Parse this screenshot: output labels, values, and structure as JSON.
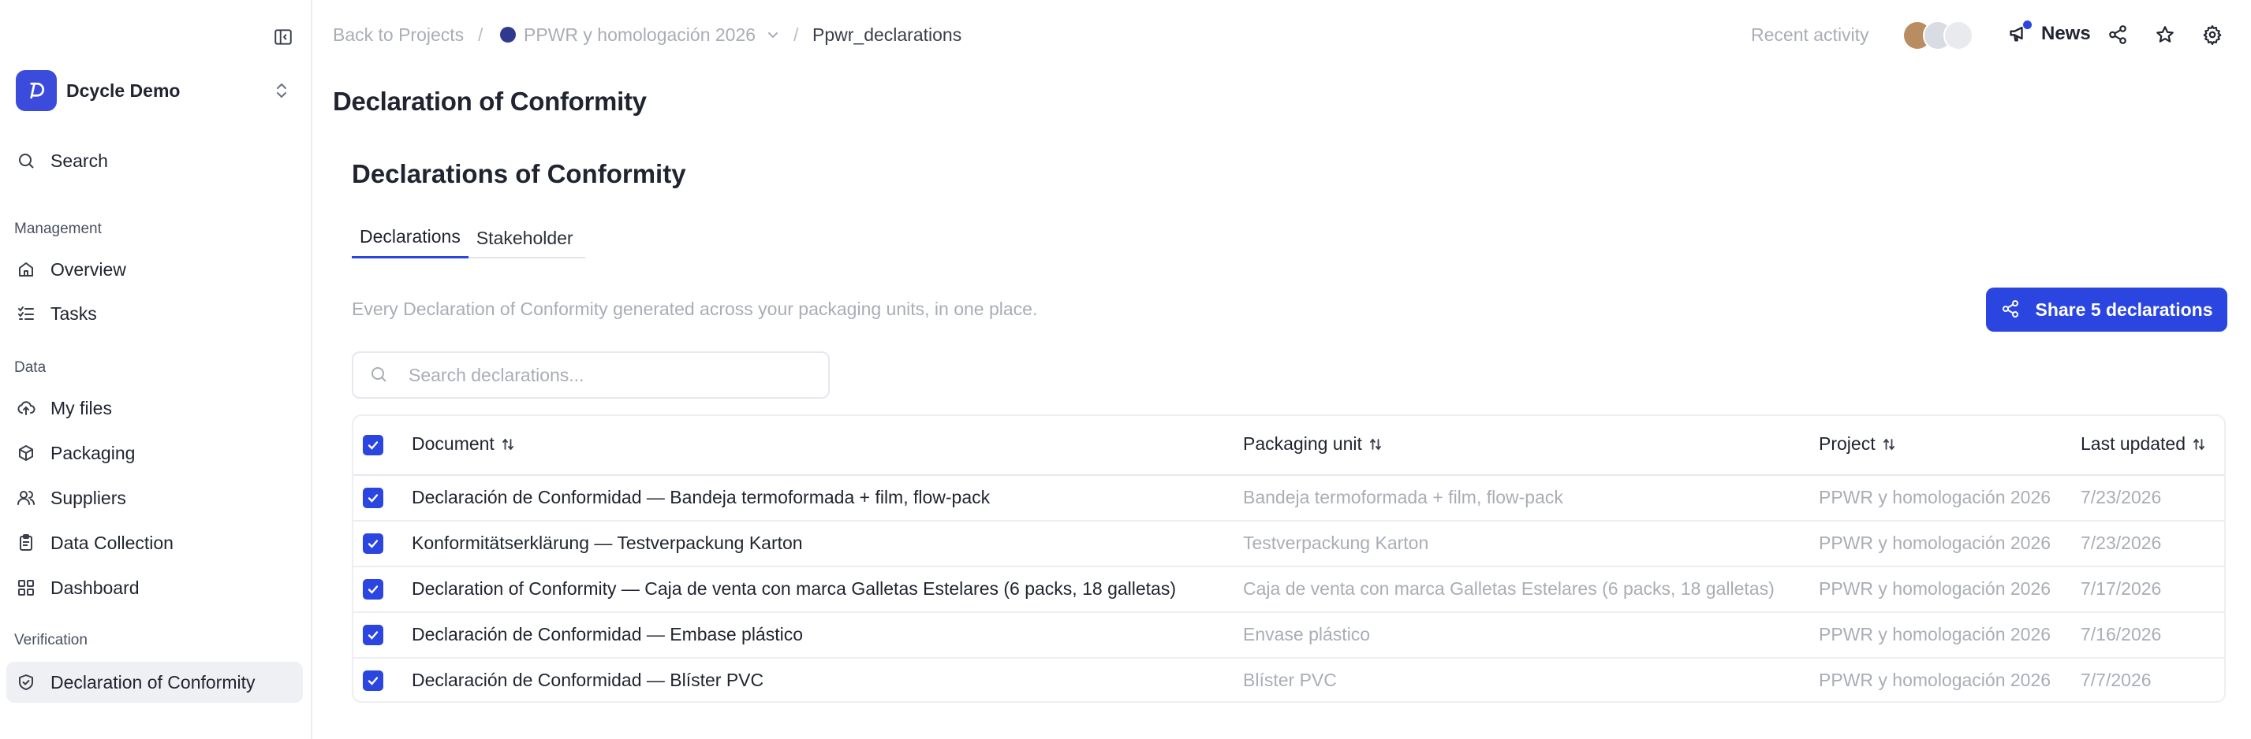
{
  "workspace": {
    "name": "Dcycle Demo"
  },
  "sidebar": {
    "search_label": "Search",
    "sections": [
      {
        "title": "Management"
      },
      {
        "title": "Data"
      },
      {
        "title": "Verification"
      }
    ],
    "items": [
      {
        "label": "Overview",
        "icon": "home-icon"
      },
      {
        "label": "Tasks",
        "icon": "tasks-icon"
      },
      {
        "label": "My files",
        "icon": "upload-cloud-icon"
      },
      {
        "label": "Packaging",
        "icon": "package-icon"
      },
      {
        "label": "Suppliers",
        "icon": "users-icon"
      },
      {
        "label": "Data Collection",
        "icon": "clipboard-icon"
      },
      {
        "label": "Dashboard",
        "icon": "dashboard-icon"
      },
      {
        "label": "Declaration of Conformity",
        "icon": "shield-check-icon",
        "active": true
      }
    ]
  },
  "breadcrumb": {
    "back": "Back to Projects",
    "sep": "/",
    "project": "PPWR y homologación 2026",
    "current": "Ppwr_declarations"
  },
  "topbar": {
    "recent_activity": "Recent activity",
    "news": "News"
  },
  "page": {
    "title": "Declaration of Conformity",
    "card_title": "Declarations of Conformity",
    "tabs": [
      {
        "label": "Declarations",
        "active": true
      },
      {
        "label": "Stakeholder",
        "active": false
      }
    ],
    "subtitle": "Every Declaration of Conformity generated across your packaging units, in one place.",
    "share_button": "Share 5 declarations",
    "search_placeholder": "Search declarations..."
  },
  "table": {
    "columns": [
      "Document",
      "Packaging unit",
      "Project",
      "Last updated"
    ],
    "rows": [
      {
        "document": "Declaración de Conformidad — Bandeja termoformada + film, flow-pack",
        "packaging": "Bandeja termoformada + film, flow-pack",
        "project": "PPWR y homologación 2026",
        "updated": "7/23/2026"
      },
      {
        "document": "Konformitätserklärung — Testverpackung Karton",
        "packaging": "Testverpackung Karton",
        "project": "PPWR y homologación 2026",
        "updated": "7/23/2026"
      },
      {
        "document": "Declaration of Conformity — Caja de venta con marca Galletas Estelares (6 packs, 18 galletas)",
        "packaging": "Caja de venta con marca Galletas Estelares (6 packs, 18 galletas)",
        "project": "PPWR y homologación 2026",
        "updated": "7/17/2026"
      },
      {
        "document": "Declaración de Conformidad — Embase plástico",
        "packaging": "Envase plástico",
        "project": "PPWR y homologación 2026",
        "updated": "7/16/2026"
      },
      {
        "document": "Declaración de Conformidad — Blíster PVC",
        "packaging": "Blíster PVC",
        "project": "PPWR y homologación 2026",
        "updated": "7/7/2026"
      }
    ]
  },
  "colors": {
    "accent": "#2b45e0",
    "muted_text": "#a9adb6",
    "brand": "#3b4bdc"
  }
}
